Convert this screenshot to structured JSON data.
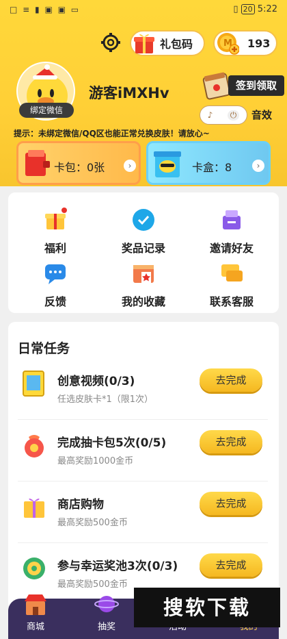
{
  "status": {
    "left_icons": "□ ≡ ▮ ▣ ▣ ▭",
    "battery": "20",
    "time": "5:22"
  },
  "header": {
    "gift_code_label": "礼包码",
    "coins": "193",
    "bind_wechat_label": "绑定微信",
    "username": "游客iMXHv",
    "checkin_label": "签到领取",
    "sound_label": "音效",
    "tip": "提示：未绑定微信/QQ区也能正常兑换皮肤！请放心~"
  },
  "cards": {
    "pack_label": "卡包：0张",
    "box_label": "卡盒：8"
  },
  "menu": {
    "items": [
      {
        "label": "福利"
      },
      {
        "label": "奖品记录"
      },
      {
        "label": "邀请好友"
      },
      {
        "label": "反馈"
      },
      {
        "label": "我的收藏"
      },
      {
        "label": "联系客服"
      }
    ]
  },
  "tasks": {
    "title": "日常任务",
    "items": [
      {
        "title": "创意视频(0/3)",
        "sub": "任选皮肤卡*1（限1次）",
        "button": "去完成"
      },
      {
        "title": "完成抽卡包5次(0/5)",
        "sub": "最高奖励1000金币",
        "button": "去完成"
      },
      {
        "title": "商店购物",
        "sub": "最高奖励500金币",
        "button": "去完成"
      },
      {
        "title": "参与幸运奖池3次(0/3)",
        "sub": "最高奖励500金币",
        "button": "去完成"
      }
    ]
  },
  "bottom_tabs": [
    {
      "label": "商城"
    },
    {
      "label": "抽奖"
    },
    {
      "label": "活动"
    },
    {
      "label": "我的"
    }
  ],
  "watermark": "搜软下载",
  "colors": {
    "yellow": "#ffd83a",
    "button": "#f5b820",
    "nav": "#3a2f5e"
  }
}
